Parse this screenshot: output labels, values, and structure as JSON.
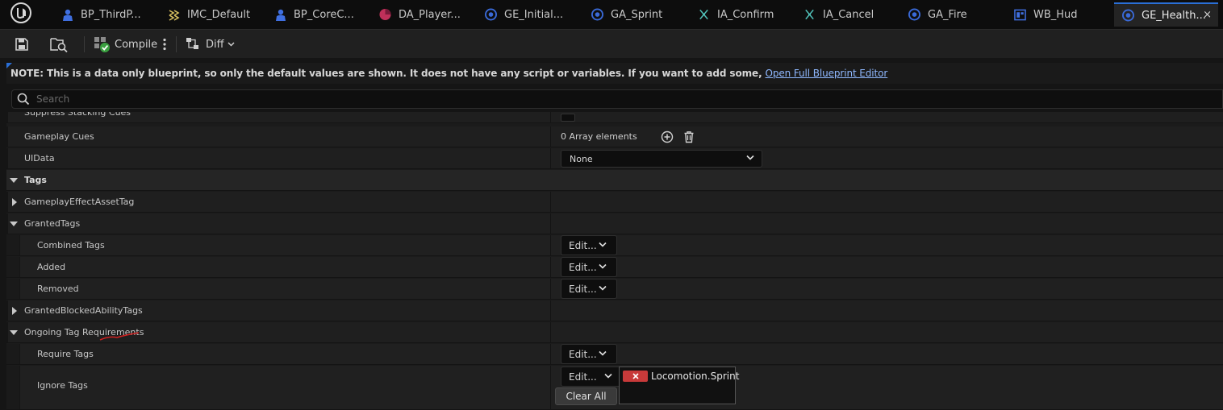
{
  "tabs": [
    {
      "label": "BP_ThirdP...",
      "icon": "person-icon",
      "color": "#3f6fe0"
    },
    {
      "label": "IMC_Default",
      "icon": "input-mapping-icon",
      "color": "#d8c060"
    },
    {
      "label": "BP_CoreC...",
      "icon": "person-icon",
      "color": "#3f6fe0"
    },
    {
      "label": "DA_Player...",
      "icon": "data-asset-icon",
      "color": "#c0305a"
    },
    {
      "label": "GE_Initial...",
      "icon": "gameplay-effect-icon",
      "color": "#3a6ad8"
    },
    {
      "label": "GA_Sprint",
      "icon": "gameplay-ability-icon",
      "color": "#3a6ad8"
    },
    {
      "label": "IA_Confirm",
      "icon": "input-action-icon",
      "color": "#50c0b8"
    },
    {
      "label": "IA_Cancel",
      "icon": "input-action-icon",
      "color": "#50c0b8"
    },
    {
      "label": "GA_Fire",
      "icon": "gameplay-ability-icon",
      "color": "#3a6ad8"
    },
    {
      "label": "WB_Hud",
      "icon": "widget-blueprint-icon",
      "color": "#3f6fe0"
    },
    {
      "label": "GE_Health...",
      "icon": "gameplay-effect-icon",
      "color": "#3a6ad8",
      "active": true
    }
  ],
  "tab_close": "×",
  "toolbar": {
    "compile_label": "Compile",
    "diff_label": "Diff"
  },
  "note": {
    "text": "NOTE: This is a data only blueprint, so only the default values are shown.  It does not have any script or variables.  If you want to add some,",
    "link": "Open Full Blueprint Editor"
  },
  "search": {
    "placeholder": "Search"
  },
  "rows": {
    "suppress_stacking_cues": "Suppress Stacking Cues",
    "gameplay_cues": "Gameplay Cues",
    "gameplay_cues_value": "0 Array elements",
    "uidata": "UIData",
    "uidata_value": "None",
    "tags_category": "Tags",
    "gameplay_effect_asset_tag": "GameplayEffectAssetTag",
    "granted_tags": "GrantedTags",
    "combined_tags": "Combined Tags",
    "added": "Added",
    "removed": "Removed",
    "granted_blocked_ability_tags": "GrantedBlockedAbilityTags",
    "ongoing_tag_requirements": "Ongoing Tag Requirements",
    "require_tags": "Require Tags",
    "ignore_tags": "Ignore Tags"
  },
  "edit_label": "Edit...",
  "clear_all_label": "Clear All",
  "ignore_tag_value": "Locomotion.Sprint",
  "colors": {
    "accent": "#2a6fd6",
    "link": "#8fb8ff",
    "tag_remove": "#c83a3a",
    "annotation": "#d02020"
  }
}
